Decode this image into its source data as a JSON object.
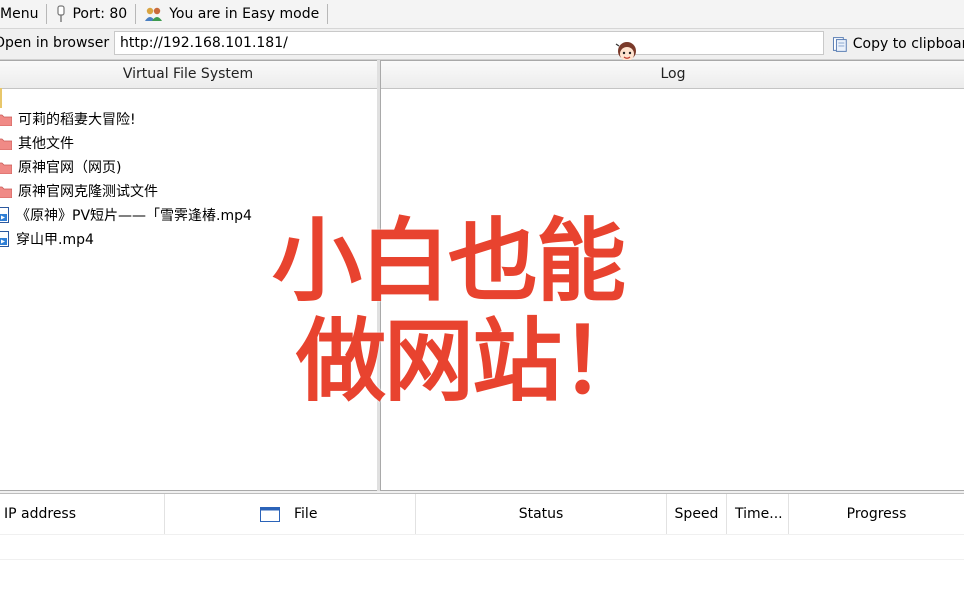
{
  "toolbar": {
    "menu_label": "Menu",
    "port_label": "Port: 80",
    "mode_label": "You are in Easy mode"
  },
  "urlbar": {
    "open_label": "Open in browser",
    "url_value": "http://192.168.101.181/",
    "copy_label": "Copy to clipboard"
  },
  "vfs": {
    "title": "Virtual File System",
    "items": [
      {
        "name": "可莉的稻妻大冒险!",
        "icon": "folder-icon"
      },
      {
        "name": "其他文件",
        "icon": "folder-icon"
      },
      {
        "name": "原神官网（网页)",
        "icon": "folder-icon"
      },
      {
        "name": "原神官网克隆测试文件",
        "icon": "folder-icon"
      },
      {
        "name": "《原神》PV短片——「雪霁逢椿.mp4",
        "icon": "video-file-icon"
      },
      {
        "name": "穿山甲.mp4",
        "icon": "video-file-icon"
      }
    ]
  },
  "log": {
    "title": "Log"
  },
  "connections": {
    "columns": [
      "IP address",
      "File",
      "Status",
      "Speed",
      "Time...",
      "Progress"
    ]
  },
  "overlay": {
    "line1": "小白也能",
    "line2": "做网站！",
    "color": "#e8432f"
  }
}
